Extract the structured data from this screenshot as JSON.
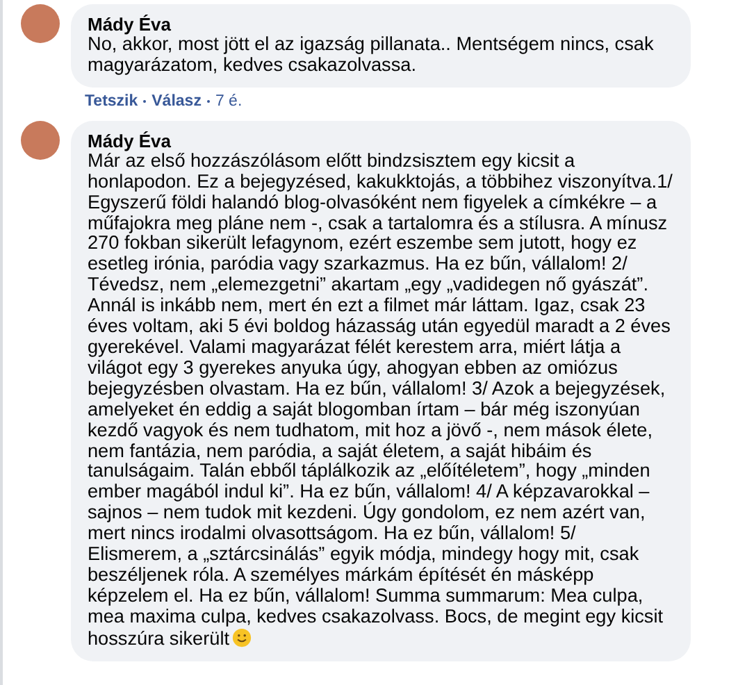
{
  "comments": [
    {
      "author": "Mády Éva",
      "text": "No, akkor, most jött el az igazság pillanata.. Mentségem nincs, csak magyarázatom, kedves csakazolvassa.",
      "smiley": false,
      "actions": [
        {
          "label": "Tetszik"
        },
        {
          "label": "Válasz"
        }
      ],
      "time": "7 é."
    },
    {
      "author": "Mády Éva",
      "text": "Már az első hozzászólásom előtt bindzsisztem egy kicsit a honlapodon. Ez a bejegyzésed, kakukktojás, a többihez viszonyítva.1/ Egyszerű földi halandó blog-olvasóként nem figyelek a címkékre – a műfajokra meg pláne nem -, csak a tartalomra és a stílusra. A mínusz 270 fokban sikerült lefagynom, ezért eszembe sem jutott, hogy ez esetleg irónia, paródia vagy szarkazmus. Ha ez bűn, vállalom! 2/ Tévedsz, nem „elemezgetni” akartam „egy „vadidegen nő gyászát”. Annál is inkább nem, mert én ezt a filmet már láttam. Igaz, csak 23 éves voltam, aki 5 évi boldog házasság után egyedül maradt a 2 éves gyerekével. Valami magyarázat félét kerestem arra, miért látja a világot egy 3 gyerekes anyuka úgy, ahogyan ebben az omiózus bejegyzésben olvastam. Ha ez bűn, vállalom! 3/ Azok a bejegyzések, amelyeket én eddig a saját blogomban írtam – bár még iszonyúan kezdő vagyok és nem tudhatom, mit hoz a jövő -, nem mások élete, nem fantázia, nem paródia, a saját életem, a saját hibáim és tanulságaim. Talán ebből táplálkozik az „előítéletem”, hogy „minden ember magából indul ki”. Ha ez bűn, vállalom! 4/ A képzavarokkal – sajnos – nem tudok mit kezdeni. Úgy gondolom, ez nem azért van, mert nincs irodalmi olvasottságom. Ha ez bűn, vállalom! 5/ Elismerem, a „sztárcsinálás” egyik módja, mindegy hogy mit, csak beszéljenek róla. A személyes márkám építését én másképp képzelem el. Ha ez bűn, vállalom! Summa summarum: Mea culpa, mea maxima culpa, kedves csakazolvass. Bocs, de megint egy kicsit hosszúra sikerült",
      "smiley": true
    }
  ]
}
